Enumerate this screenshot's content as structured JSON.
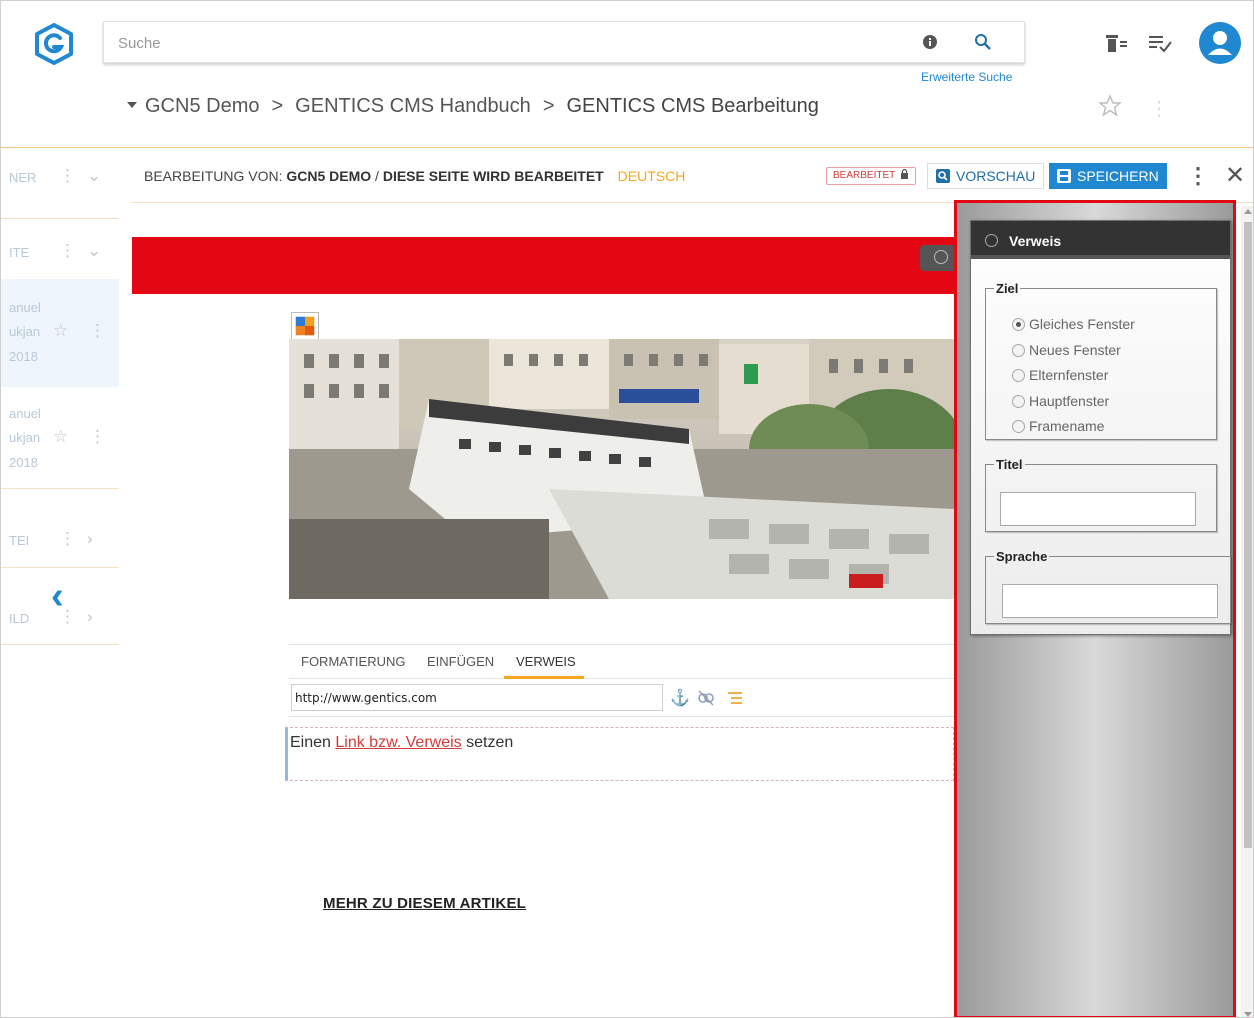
{
  "header": {
    "search_placeholder": "Suche",
    "advanced_search": "Erweiterte Suche",
    "breadcrumbs": [
      "GCN5 Demo",
      "GENTICS CMS Handbuch",
      "GENTICS CMS Bearbeitung"
    ],
    "icons": [
      "info-icon",
      "search-icon",
      "wastebin-icon",
      "message-list-icon",
      "user-avatar-icon",
      "favourite-star-icon",
      "more-icon"
    ]
  },
  "sidebar": {
    "items": [
      {
        "label": "NER"
      },
      {
        "label": "ITE"
      },
      {
        "line1": "anuel",
        "line2": "ukjan",
        "line3": "2018"
      },
      {
        "line1": "anuel",
        "line2": "ukjan",
        "line3": "2018"
      },
      {
        "label": "TEI"
      },
      {
        "label": "ILD"
      }
    ]
  },
  "editbar": {
    "prefix": "BEARBEITUNG VON:",
    "node": "GCN5 DEMO",
    "separator": "/",
    "page": "DIESE SEITE WIRD BEARBEITET",
    "language": "DEUTSCH",
    "status_badge": "BEARBEITET",
    "preview_label": "VORSCHAU",
    "save_label": "SPEICHERN"
  },
  "content": {
    "tabs": [
      "FORMATIERUNG",
      "EINFÜGEN",
      "VERWEIS"
    ],
    "active_tab": "VERWEIS",
    "url_value": "http://www.gentics.com",
    "editor_text_before": "Einen ",
    "editor_link": "Link bzw. Verweis",
    "editor_text_after": " setzen",
    "more_link": "MEHR ZU DIESEM ARTIKEL"
  },
  "panel": {
    "title": "Verweis",
    "target_legend": "Ziel",
    "targets": [
      {
        "label": "Gleiches Fenster",
        "checked": true
      },
      {
        "label": "Neues Fenster",
        "checked": false
      },
      {
        "label": "Elternfenster",
        "checked": false
      },
      {
        "label": "Hauptfenster",
        "checked": false
      },
      {
        "label": "Framename",
        "checked": false
      }
    ],
    "title_legend": "Titel",
    "title_value": "",
    "language_legend": "Sprache",
    "language_value": ""
  },
  "colors": {
    "accent": "#1f88d1",
    "brand_red": "#e30613",
    "highlight_orange": "#f5a623"
  }
}
